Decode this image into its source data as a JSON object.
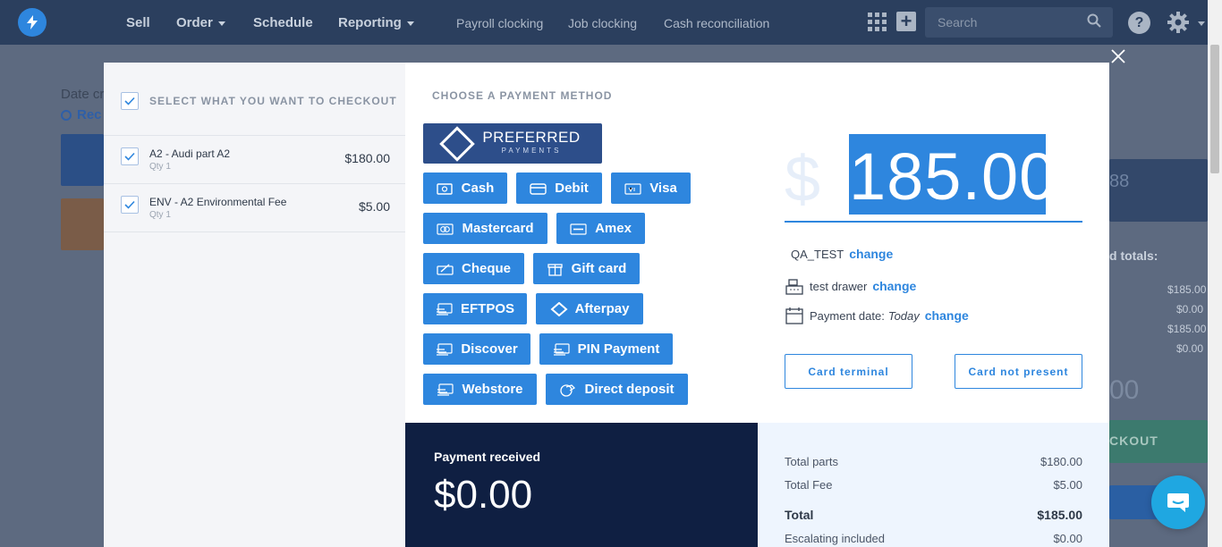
{
  "nav": {
    "items": [
      {
        "label": "Sell",
        "caret": false
      },
      {
        "label": "Order",
        "caret": true
      },
      {
        "label": "Schedule",
        "caret": false
      },
      {
        "label": "Reporting",
        "caret": true
      }
    ],
    "secondary": [
      "Payroll clocking",
      "Job clocking",
      "Cash reconciliation"
    ],
    "search_placeholder": "Search",
    "help_label": "?"
  },
  "background": {
    "date_label": "Date cr",
    "rec_label": "Rec",
    "num_fragment": "88",
    "totals_fragment": "d totals:",
    "values": [
      "$185.00",
      "$0.00",
      "$185.00",
      "$0.00"
    ],
    "big_fragment": "00",
    "checkout_fragment": "CKOUT"
  },
  "checkout": {
    "header": "SELECT WHAT YOU WANT TO CHECKOUT",
    "items": [
      {
        "name": "A2 - Audi part A2",
        "qty": "Qty 1",
        "price": "$180.00"
      },
      {
        "name": "ENV - A2 Environmental Fee",
        "qty": "Qty 1",
        "price": "$5.00"
      }
    ]
  },
  "payment": {
    "title": "CHOOSE A PAYMENT METHOD",
    "preferred": {
      "main": "PREFERRED",
      "sub": "PAYMENTS"
    },
    "methods": [
      {
        "label": "Cash",
        "icon": "cash-icon"
      },
      {
        "label": "Debit",
        "icon": "card-icon"
      },
      {
        "label": "Visa",
        "icon": "visa-icon"
      },
      {
        "label": "Mastercard",
        "icon": "mastercard-icon"
      },
      {
        "label": "Amex",
        "icon": "amex-icon"
      },
      {
        "label": "Cheque",
        "icon": "cheque-icon"
      },
      {
        "label": "Gift card",
        "icon": "gift-icon"
      },
      {
        "label": "EFTPOS",
        "icon": "card-swipe-icon"
      },
      {
        "label": "Afterpay",
        "icon": "afterpay-icon"
      },
      {
        "label": "Discover",
        "icon": "card-swipe-icon"
      },
      {
        "label": "PIN Payment",
        "icon": "card-swipe-icon"
      },
      {
        "label": "Webstore",
        "icon": "card-swipe-icon"
      },
      {
        "label": "Direct deposit",
        "icon": "deposit-icon"
      }
    ],
    "currency_symbol": "$",
    "amount": "185.00",
    "customer": "QA_TEST",
    "change_label": "change",
    "drawer": "test drawer",
    "date_label": "Payment date:",
    "date_value": "Today",
    "card_terminal": "Card terminal",
    "card_not_present": "Card not present"
  },
  "received": {
    "label": "Payment received",
    "value": "$0.00"
  },
  "totals": [
    {
      "label": "Total parts",
      "value": "$180.00",
      "bold": false
    },
    {
      "label": "Total Fee",
      "value": "$5.00",
      "bold": false
    },
    {
      "label": "Total",
      "value": "$185.00",
      "bold": true
    },
    {
      "label": "Escalating included",
      "value": "$0.00",
      "bold": false
    }
  ],
  "colors": {
    "accent": "#2e86de",
    "nav": "#2b3f5e",
    "dark_panel": "#0f1f42"
  }
}
